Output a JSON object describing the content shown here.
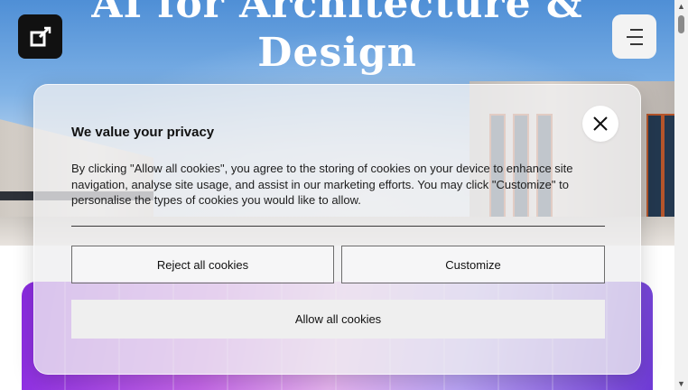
{
  "hero": {
    "title_line1": "AI for Architecture &",
    "title_line2": "Design"
  },
  "header": {
    "logo_icon": "brand-logo-icon",
    "menu_icon": "menu-icon"
  },
  "cookie_banner": {
    "title": "We value your privacy",
    "body": "By clicking \"Allow all cookies\", you agree to the storing of cookies on your device to enhance site navigation, analyse site usage, and assist in our marketing efforts. You may click \"Customize\" to personalise the types of cookies you would like to allow.",
    "close_icon": "close-icon",
    "reject_label": "Reject all cookies",
    "customize_label": "Customize",
    "allow_label": "Allow all cookies"
  },
  "colors": {
    "card_gradient_start": "#8a2be2",
    "card_gradient_end": "#6f3ad6",
    "logo_background": "#111111"
  }
}
